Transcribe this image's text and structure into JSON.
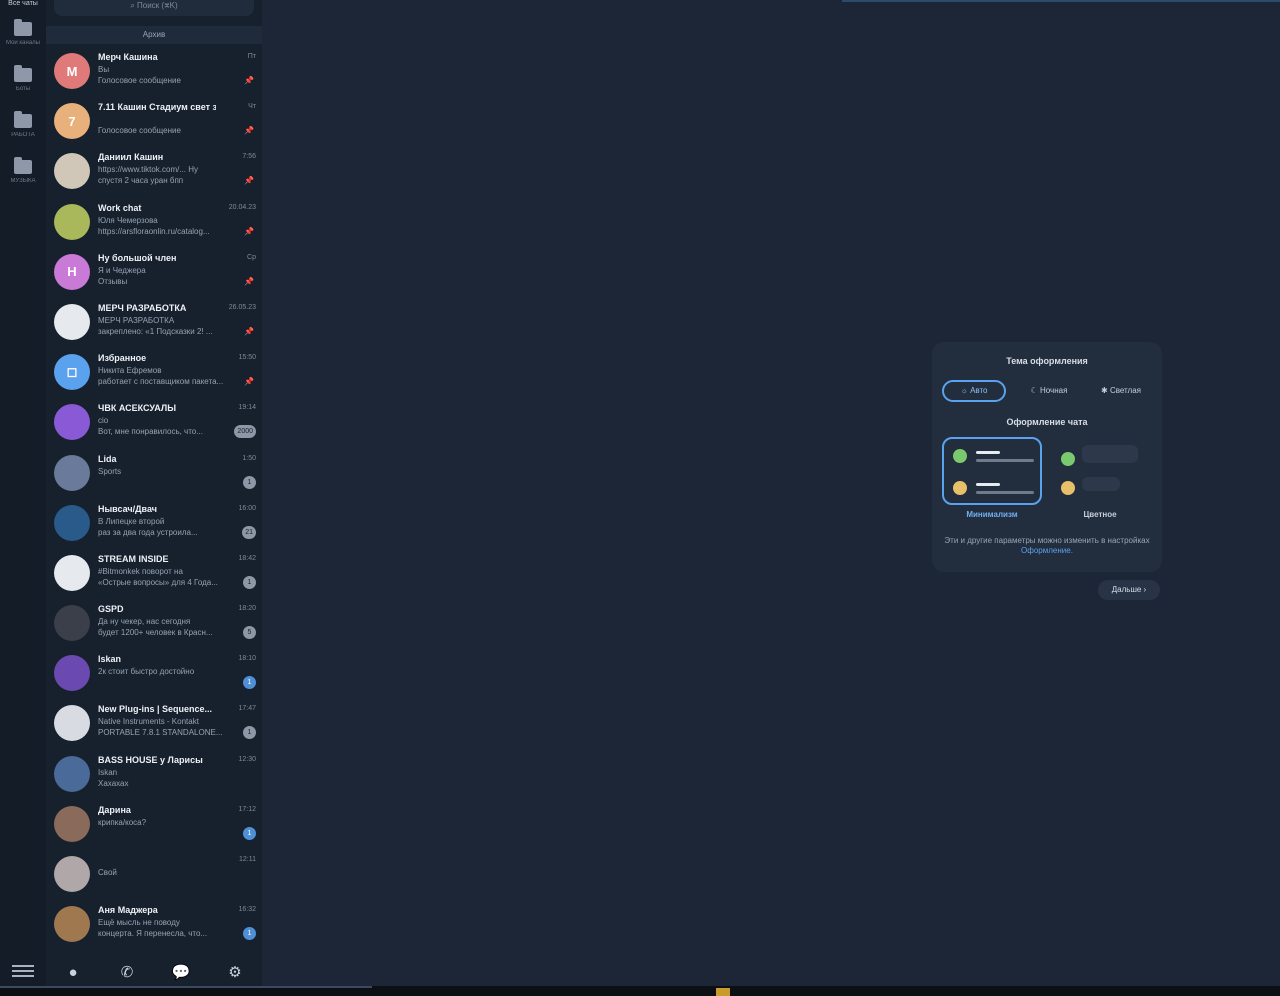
{
  "rail": {
    "top_label": "Все чаты",
    "folders": [
      {
        "label": "Мои каналы"
      },
      {
        "label": "Боты"
      },
      {
        "label": "РАБОТА"
      },
      {
        "label": "МУЗЫКА"
      }
    ]
  },
  "sidebar": {
    "search_placeholder": "Поиск (⌘K)",
    "archive_label": "Архив",
    "chats": [
      {
        "name": "Мерч Кашина",
        "time": "Пт",
        "msg": "Вы\nГолосовое сообщение",
        "avatar": "М",
        "color": "#e07a7a",
        "pin": true
      },
      {
        "name": "7.11 Кашин Стадиум свет за...",
        "time": "Чт",
        "msg": "\nГолосовое сообщение",
        "avatar": "7",
        "color": "#e8b07a",
        "pin": true
      },
      {
        "name": "Даниил Кашин",
        "time": "7:56",
        "msg": "https://www.tiktok.com/... Ну\nспустя 2 часа уран бпп",
        "avatar": "",
        "color": "#d0c7b8",
        "pin": true
      },
      {
        "name": "Work chat",
        "time": "20.04.23",
        "msg": "Юля Чемерзова\nhttps://arsfloraonlin.ru/catalog...",
        "avatar": "",
        "color": "#a8b85a",
        "pin": true
      },
      {
        "name": "Ну большой член",
        "time": "Ср",
        "msg": "Я и Чеджера\nОтзывы",
        "avatar": "Н",
        "color": "#c87ad6",
        "pin": true
      },
      {
        "name": "МЕРЧ РАЗРАБОТКА",
        "time": "26.05.23",
        "msg": "МЕРЧ РАЗРАБОТКА\nзакреплено: «1 Подсказки 2! ...",
        "avatar": "",
        "color": "#e6e9ee",
        "pin": true
      },
      {
        "name": "Избранное",
        "time": "15:50",
        "msg": "Никита Ефремов\nработает с поставщиком пакета...",
        "avatar": "◻",
        "color": "#5aa2ee",
        "pin": true
      },
      {
        "name": "ЧВК АСЕКСУАЛЫ",
        "time": "19:14",
        "msg": "cio\nВот, мне понравилось, что...",
        "avatar": "",
        "color": "#8a5ad6",
        "badge": "2000"
      },
      {
        "name": "Lida",
        "time": "1:50",
        "msg": "Sports\n",
        "avatar": "",
        "color": "#6a7a9a",
        "badge": "1"
      },
      {
        "name": "Нывсач/Двач",
        "time": "16:00",
        "msg": "В Липецке второй\nраз за два года устроила...",
        "avatar": "",
        "color": "#2a5a8a",
        "badge": "21"
      },
      {
        "name": "STREAM INSIDE",
        "time": "18:42",
        "msg": "#Bitmonkek поворот на\n«Острые вопросы» для 4 Года...",
        "avatar": "",
        "color": "#e6e9ee",
        "badge": "1"
      },
      {
        "name": "GSPD",
        "time": "18:20",
        "msg": "Да ну чекер, нас сегодня\nбудет 1200+ человек в Красн...",
        "avatar": "",
        "color": "#3a3f4a",
        "badge": "5"
      },
      {
        "name": "Iskan",
        "time": "18:10",
        "msg": "2к стоит быстро достойно\n",
        "avatar": "",
        "color": "#6a4ab0",
        "badge": "1",
        "blue": true
      },
      {
        "name": "New Plug-ins | Sequence...",
        "time": "17:47",
        "msg": "Native Instruments - Kontakt\nPORTABLE 7.8.1 STANDALONE...",
        "avatar": "",
        "color": "#d8dce2",
        "badge": "1"
      },
      {
        "name": "BASS HOUSE у Ларисы",
        "time": "12:30",
        "msg": "Iskan\nХахахах",
        "avatar": "",
        "color": "#4a6a9a"
      },
      {
        "name": "Дарина",
        "time": "17:12",
        "msg": "крипка/коса?\n",
        "avatar": "",
        "color": "#8a6a5a",
        "badge": "1",
        "blue": true
      },
      {
        "name": "",
        "time": "12:11",
        "msg": "Свой\n",
        "avatar": "",
        "color": "#b0a8a8"
      },
      {
        "name": "Аня Маджера",
        "time": "16:32",
        "msg": "Ещё мысль не поводу\nконцерта. Я перенесла, что...",
        "avatar": "",
        "color": "#a07850",
        "badge": "1",
        "blue": true
      }
    ]
  },
  "panel": {
    "title": "Тема оформления",
    "themes": [
      {
        "label": "Авто",
        "icon": "sun-moon-icon"
      },
      {
        "label": "Ночная",
        "icon": "moon-icon"
      },
      {
        "label": "Светлая",
        "icon": "sun-icon"
      }
    ],
    "chat_style_title": "Оформление чата",
    "styles": [
      {
        "label": "Минимализм"
      },
      {
        "label": "Цветное"
      }
    ],
    "note": "Эти и другие параметры можно изменить в настройках",
    "note_link": "Оформление.",
    "accent": "#5aa2ee"
  },
  "next_button": "Дальше ›"
}
